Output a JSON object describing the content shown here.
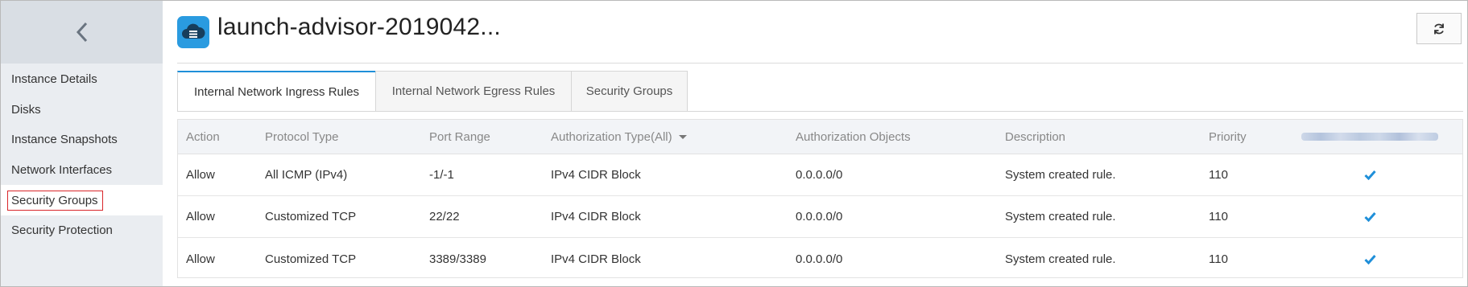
{
  "sidebar": {
    "items": [
      {
        "label": "Instance Details"
      },
      {
        "label": "Disks"
      },
      {
        "label": "Instance Snapshots"
      },
      {
        "label": "Network Interfaces"
      },
      {
        "label": "Security Groups"
      },
      {
        "label": "Security Protection"
      }
    ],
    "active_item": "Security Groups"
  },
  "header": {
    "title": "launch-advisor-2019042...",
    "icon": "cloud-server-icon",
    "refresh_icon": "refresh-icon"
  },
  "tabs": [
    {
      "label": "Internal Network Ingress Rules",
      "active": true
    },
    {
      "label": "Internal Network Egress Rules",
      "active": false
    },
    {
      "label": "Security Groups",
      "active": false
    }
  ],
  "table": {
    "columns": [
      "Action",
      "Protocol Type",
      "Port Range",
      "Authorization Type(All)",
      "Authorization Objects",
      "Description",
      "Priority",
      ""
    ],
    "rows": [
      {
        "action": "Allow",
        "protocol": "All ICMP (IPv4)",
        "port": "-1/-1",
        "auth_type": "IPv4 CIDR Block",
        "auth_objects": "0.0.0.0/0",
        "description": "System created rule.",
        "priority": "110",
        "status_icon": "checkmark-icon"
      },
      {
        "action": "Allow",
        "protocol": "Customized TCP",
        "port": "22/22",
        "auth_type": "IPv4 CIDR Block",
        "auth_objects": "0.0.0.0/0",
        "description": "System created rule.",
        "priority": "110",
        "status_icon": "checkmark-icon"
      },
      {
        "action": "Allow",
        "protocol": "Customized TCP",
        "port": "3389/3389",
        "auth_type": "IPv4 CIDR Block",
        "auth_objects": "0.0.0.0/0",
        "description": "System created rule.",
        "priority": "110",
        "status_icon": "checkmark-icon"
      }
    ]
  },
  "colors": {
    "accent": "#2a9be0",
    "tab_active_border": "#1f8fd9",
    "highlight_box": "#d9262a",
    "check": "#1f8fd9",
    "sidebar_bg": "#eaedf1"
  }
}
